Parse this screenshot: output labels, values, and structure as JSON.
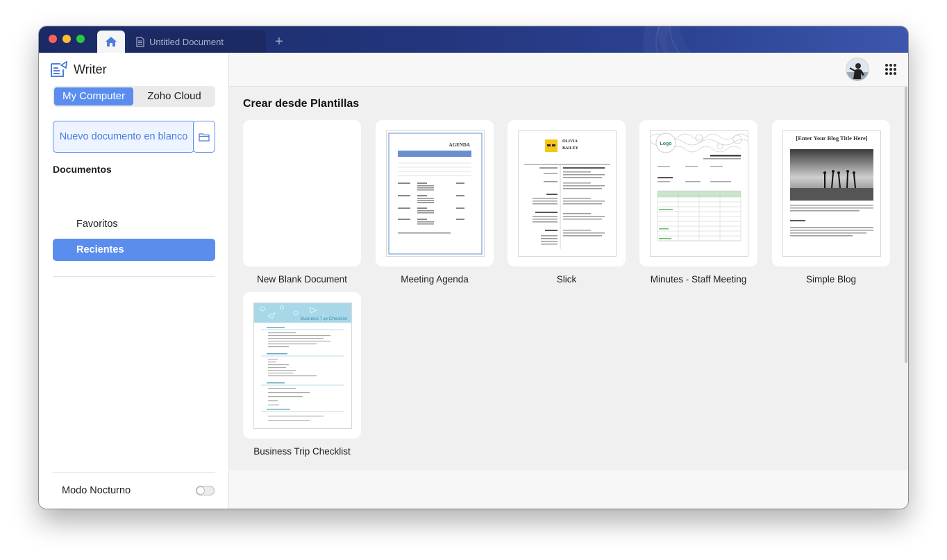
{
  "titlebar": {
    "tabs": [
      {
        "label": "",
        "icon": "home-icon",
        "active": true
      },
      {
        "label": "Untitled Document",
        "icon": "document-icon",
        "active": false
      }
    ],
    "new_tab_label": "+"
  },
  "sidebar": {
    "app_name": "Writer",
    "storage_tabs": [
      "My Computer",
      "Zoho Cloud"
    ],
    "new_doc_label": "Nuevo documento en blanco",
    "section_title": "Documentos",
    "nav_items": [
      {
        "label": "Favoritos",
        "active": false
      },
      {
        "label": "Recientes",
        "active": true
      }
    ],
    "night_mode_label": "Modo Nocturno",
    "night_mode_on": false
  },
  "main": {
    "heading": "Crear desde Plantillas",
    "templates": [
      {
        "label": "New Blank Document"
      },
      {
        "label": "Meeting Agenda"
      },
      {
        "label": "Slick"
      },
      {
        "label": "Minutes - Staff Meeting"
      },
      {
        "label": "Simple Blog"
      },
      {
        "label": "Business Trip Checklist"
      }
    ],
    "thumbnails": {
      "agenda_title": "AGENDA",
      "slick_name_1": "OLIVIA",
      "slick_name_2": "BAILEY",
      "logo_text": "Logo",
      "blog_title": "[Enter Your Blog Title Here]",
      "trip_title": "Business Trip Checklist"
    }
  },
  "colors": {
    "accent": "#5b8def",
    "titlebar": "#23357c"
  }
}
